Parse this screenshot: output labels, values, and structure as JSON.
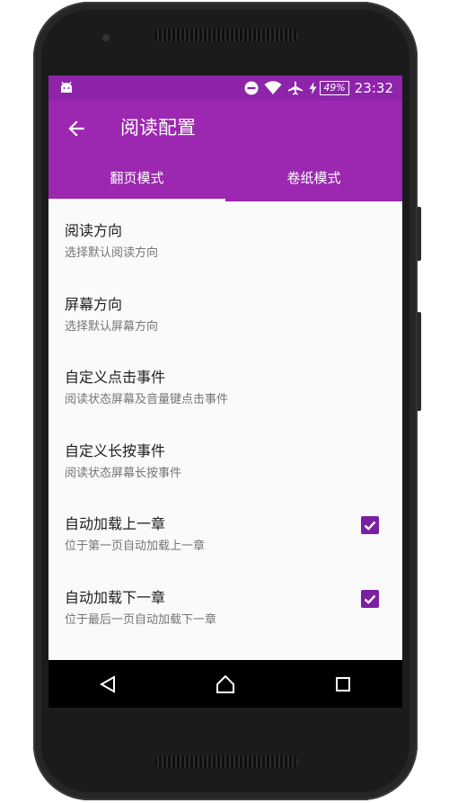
{
  "colors": {
    "status_bar": "#8e24aa",
    "app_bar": "#9c27b0",
    "accent": "#7b1fa2",
    "nav_bar": "#000000"
  },
  "status_bar": {
    "left_icon": "android-debug-icon",
    "icons": [
      "do-not-disturb-icon",
      "wifi-icon",
      "airplane-icon",
      "charging-icon"
    ],
    "battery": "49%",
    "time": "23:32"
  },
  "app_bar": {
    "back_icon": "arrow-back-icon",
    "title": "阅读配置"
  },
  "tabs": [
    {
      "label": "翻页模式",
      "active": true
    },
    {
      "label": "卷纸模式",
      "active": false
    }
  ],
  "settings": [
    {
      "title": "阅读方向",
      "subtitle": "选择默认阅读方向"
    },
    {
      "title": "屏幕方向",
      "subtitle": "选择默认屏幕方向"
    },
    {
      "title": "自定义点击事件",
      "subtitle": "阅读状态屏幕及音量键点击事件"
    },
    {
      "title": "自定义长按事件",
      "subtitle": "阅读状态屏幕长按事件"
    },
    {
      "title": "自动加载上一章",
      "subtitle": "位于第一页自动加载上一章",
      "checked": true
    },
    {
      "title": "自动加载下一章",
      "subtitle": "位于最后一页自动加载下一章",
      "checked": true
    }
  ],
  "nav_bar": {
    "icons": [
      "back-triangle-icon",
      "home-icon",
      "recents-icon"
    ]
  }
}
